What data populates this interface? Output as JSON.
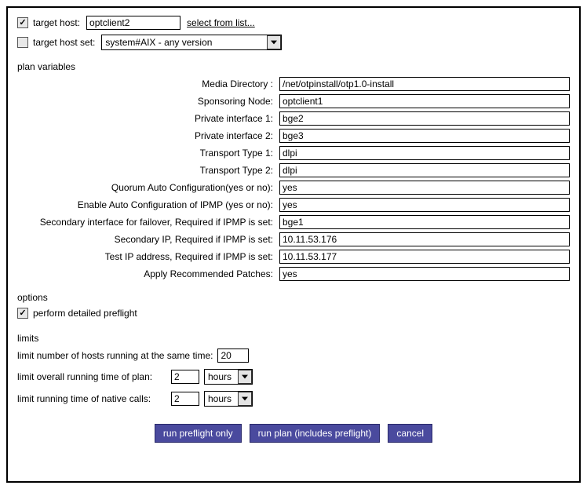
{
  "target": {
    "host_label": "target host:",
    "host_value": "optclient2",
    "host_checked": true,
    "select_link": "select from list...",
    "hostset_label": "target host set:",
    "hostset_value": "system#AIX - any version",
    "hostset_checked": false
  },
  "plan_vars_title": "plan variables",
  "plan_vars": [
    {
      "label": "Media Directory :",
      "value": "/net/otpinstall/otp1.0-install"
    },
    {
      "label": "Sponsoring Node:",
      "value": "optclient1"
    },
    {
      "label": "Private interface 1:",
      "value": "bge2"
    },
    {
      "label": "Private interface 2:",
      "value": "bge3"
    },
    {
      "label": "Transport Type 1:",
      "value": "dlpi"
    },
    {
      "label": "Transport Type 2:",
      "value": "dlpi"
    },
    {
      "label": "Quorum Auto Configuration(yes or no):",
      "value": "yes"
    },
    {
      "label": "Enable Auto Configuration of IPMP (yes or no):",
      "value": "yes"
    },
    {
      "label": "Secondary interface for failover, Required if IPMP is set:",
      "value": "bge1"
    },
    {
      "label": "Secondary IP, Required if IPMP is set:",
      "value": "10.11.53.176"
    },
    {
      "label": "Test IP address, Required if IPMP is set:",
      "value": "10.11.53.177"
    },
    {
      "label": "Apply Recommended Patches:",
      "value": "yes"
    }
  ],
  "options": {
    "title": "options",
    "preflight_label": "perform detailed preflight",
    "preflight_checked": true
  },
  "limits": {
    "title": "limits",
    "hosts_label": "limit number of hosts running at the same time:",
    "hosts_value": "20",
    "plan_time_label": "limit overall running time of plan:",
    "plan_time_value": "2",
    "plan_time_unit": "hours",
    "native_time_label": "limit running time of native calls:",
    "native_time_value": "2",
    "native_time_unit": "hours"
  },
  "buttons": {
    "preflight": "run preflight only",
    "run_plan": "run plan (includes preflight)",
    "cancel": "cancel"
  }
}
